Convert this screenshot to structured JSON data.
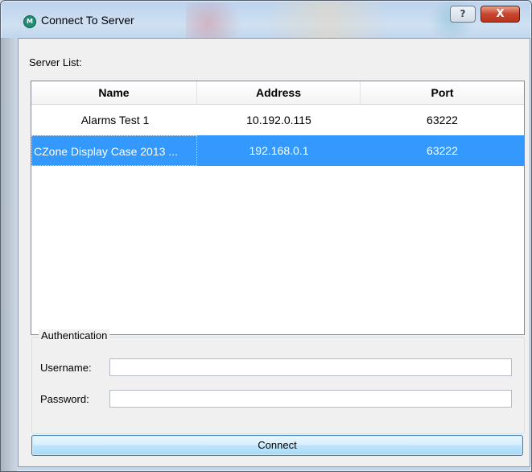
{
  "window": {
    "title": "Connect To Server",
    "app_icon_glyph": "M",
    "help_button": "?",
    "close_button": "X",
    "colors": {
      "selection": "#3399ff",
      "close": "#c8452e",
      "title_frame": "#cfe0f2"
    }
  },
  "server_list": {
    "label": "Server List:",
    "columns": [
      "Name",
      "Address",
      "Port"
    ],
    "rows": [
      {
        "name": "Alarms Test 1",
        "address": "10.192.0.115",
        "port": "63222"
      },
      {
        "name": "CZone Display Case 2013 ...",
        "address": "192.168.0.1",
        "port": "63222",
        "selected": true
      }
    ]
  },
  "authentication": {
    "group_label": "Authentication",
    "username_label": "Username:",
    "username_value": "",
    "password_label": "Password:",
    "password_value": ""
  },
  "actions": {
    "connect_label": "Connect"
  }
}
